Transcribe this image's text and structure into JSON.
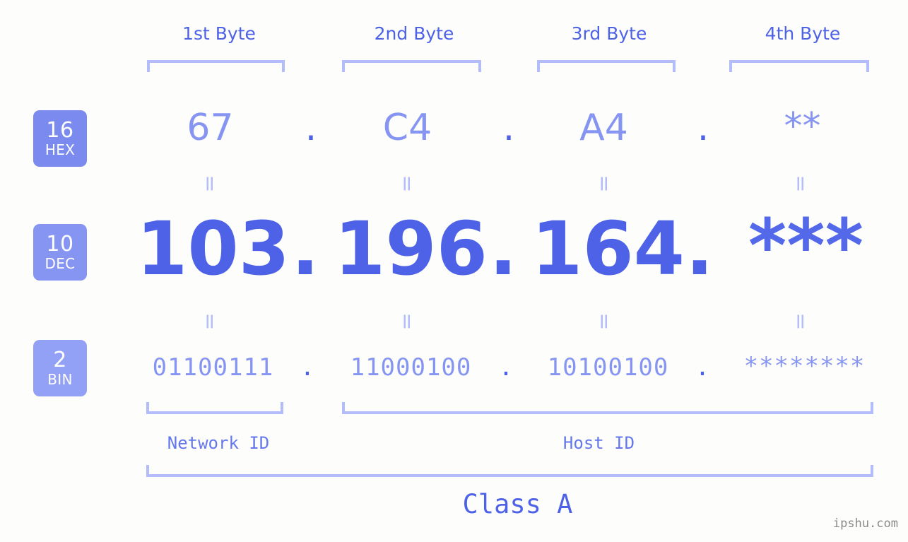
{
  "page": {
    "background_color": "#fdfefb",
    "accent_dark": "#4e62e8",
    "accent_mid": "#8795f2",
    "accent_light": "#b4bdfb",
    "watermark": "ipshu.com"
  },
  "byte_headers": [
    {
      "label": "1st Byte"
    },
    {
      "label": "2nd Byte"
    },
    {
      "label": "3rd Byte"
    },
    {
      "label": "4th Byte"
    }
  ],
  "bases": [
    {
      "number": "16",
      "name": "HEX",
      "color": "#7b8aee"
    },
    {
      "number": "10",
      "name": "DEC",
      "color": "#8795f2"
    },
    {
      "number": "2",
      "name": "BIN",
      "color": "#92a0f6"
    }
  ],
  "rows": {
    "hex": {
      "base_number": "16",
      "base_name": "HEX",
      "values": [
        "67",
        "C4",
        "A4",
        "**"
      ],
      "separator": "."
    },
    "dec": {
      "base_number": "10",
      "base_name": "DEC",
      "values": [
        "103",
        "196",
        "164",
        "***"
      ],
      "separator": "."
    },
    "bin": {
      "base_number": "2",
      "base_name": "BIN",
      "values": [
        "01100111",
        "11000100",
        "10100100",
        "********"
      ],
      "separator": "."
    }
  },
  "connectors": {
    "symbol": "="
  },
  "footer": {
    "network_id_label": "Network ID",
    "host_id_label": "Host ID",
    "class_label": "Class A"
  }
}
